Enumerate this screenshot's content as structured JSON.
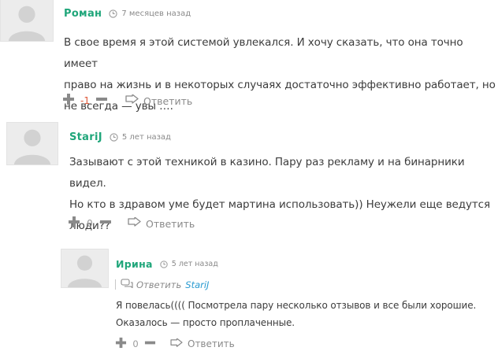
{
  "comments": [
    {
      "author": "Роман",
      "time": "7 месяцев назад",
      "text_lines": [
        "В свое время я этой системой увлекался. И хочу сказать, что она точно имеет",
        "право на жизнь и в некоторых случаях достаточно эффективно работает, но",
        "не всегда — увы …."
      ],
      "vote_count": "-1",
      "reply_label": "Ответить"
    },
    {
      "author": "StariJ",
      "time": "5 лет назад",
      "text_lines": [
        "Зазывают с этой техникой в казино. Пару раз рекламу и на бинарники видел.",
        "Но кто в здравом уме будет мартина использовать)) Неужели еще ведутся",
        "люди??"
      ],
      "vote_count": "0",
      "reply_label": "Ответить"
    },
    {
      "author": "Ирина",
      "time": "5 лет назад",
      "reply_to_label": "Ответить",
      "reply_to_name": "StariJ",
      "text_lines": [
        "Я повелась(((( Посмотрела пару несколько отзывов и все были хорошие.",
        "Оказалось — просто проплаченные."
      ],
      "vote_count": "0",
      "reply_label": "Ответить"
    }
  ],
  "colors": {
    "author": "#1fa67a",
    "negative_count": "#e05a3a",
    "link": "#2a9bd1"
  },
  "icons": [
    "avatar-placeholder",
    "clock-icon",
    "plus-icon",
    "minus-icon",
    "reply-arrow-icon",
    "reply-to-icon"
  ]
}
